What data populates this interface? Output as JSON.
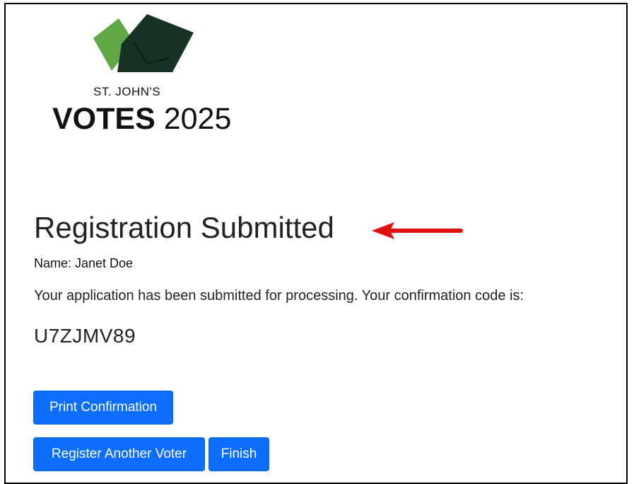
{
  "logo": {
    "line1": "ST. JOHN'S",
    "line2_bold": "VOTES",
    "line2_year": " 2025",
    "colors": {
      "light_green": "#5fa644",
      "dark_green": "#163325"
    }
  },
  "confirmation": {
    "heading": "Registration Submitted",
    "name_line": "Name: Janet Doe",
    "message": "Your application has been submitted for processing. Your confirmation code is:",
    "code": "U7ZJMV89"
  },
  "actions": {
    "print_label": "Print Confirmation",
    "register_another_label": "Register Another Voter",
    "finish_label": "Finish"
  },
  "annotation": {
    "arrow_color": "#e01010",
    "icon": "arrow-left-icon"
  },
  "theme": {
    "primary": "#0d6efd"
  }
}
